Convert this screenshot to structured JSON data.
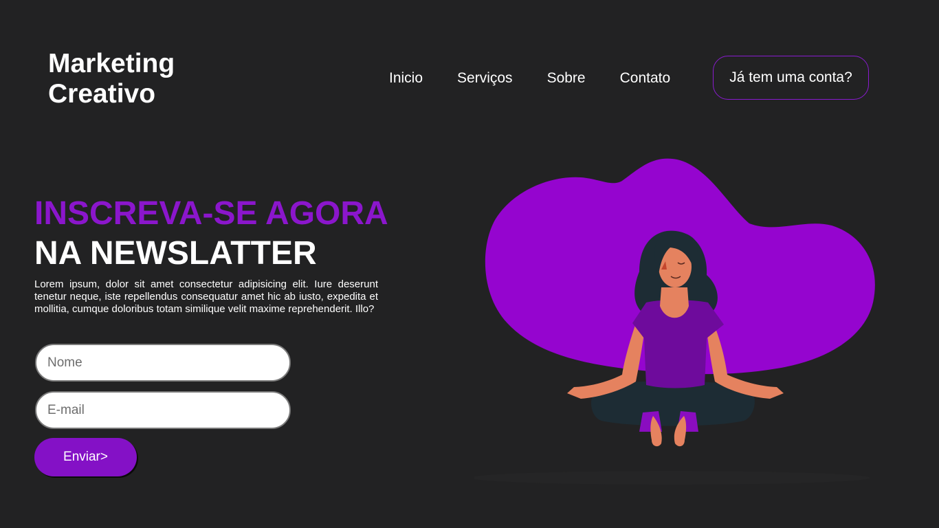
{
  "brand": {
    "line1": "Marketing",
    "line2": "Creativo"
  },
  "nav": {
    "items": [
      {
        "label": "Inicio"
      },
      {
        "label": "Serviços"
      },
      {
        "label": "Sobre"
      },
      {
        "label": "Contato"
      }
    ],
    "login_label": "Já tem uma conta?"
  },
  "hero": {
    "headline_accent": "INSCREVA-SE AGORA",
    "headline_main": "NA NEWSLATTER",
    "description": "Lorem ipsum, dolor sit amet consectetur adipisicing elit. Iure deserunt tenetur neque, iste repellendus consequatur amet hic ab iusto, expedita et mollitia, cumque doloribus totam similique velit maxime reprehenderit. Illo?"
  },
  "form": {
    "name_placeholder": "Nome",
    "name_value": "",
    "email_placeholder": "E-mail",
    "email_value": "",
    "submit_label": "Enviar>"
  },
  "colors": {
    "background": "#222223",
    "accent": "#8b16cc",
    "blob": "#9505cf",
    "button": "#8411c6"
  },
  "illustration": {
    "icon": "meditating-woman-illustration"
  }
}
